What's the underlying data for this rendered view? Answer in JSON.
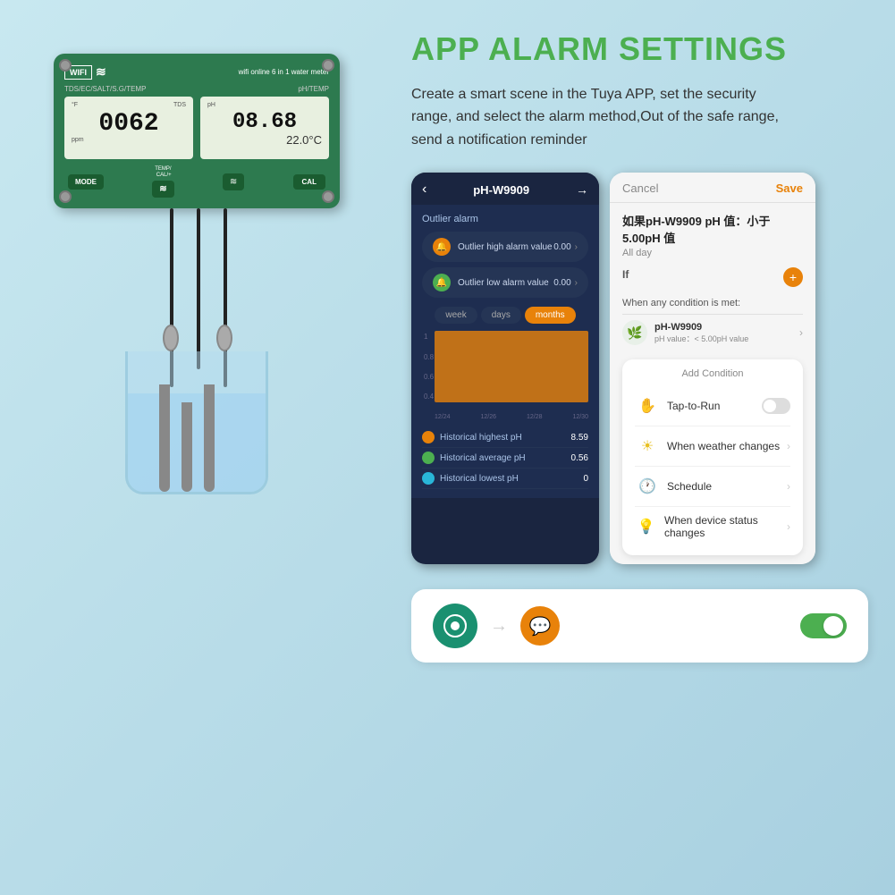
{
  "page": {
    "background": "#c8e8f0"
  },
  "header": {
    "title": "APP ALARM SETTINGS"
  },
  "description": {
    "text": "Create a smart scene in the Tuya APP, set the security range, and select the alarm method,Out of the safe range, send a notification reminder"
  },
  "device": {
    "wifi_label": "WIFI",
    "device_name": "wifi online 6 in 1 water meter",
    "left_screen_label_top": "TDS/EC/SALT/S.G/TEMP",
    "left_screen_unit": "ppm",
    "left_screen_value": "0062",
    "left_screen_sublabel": "TDS",
    "right_screen_label_top": "pH/TEMP",
    "right_screen_value": "08.68",
    "right_screen_temp": "22.0°C",
    "btn_mode": "MODE",
    "btn_cal": "CAL",
    "temp_label": "TEMP/\nCAL/+"
  },
  "phone_dark": {
    "back_icon": "‹",
    "title": "pH-W9909",
    "menu_icon": "≡",
    "section_title": "Outlier alarm",
    "alarm_high_label": "Outlier high alarm value",
    "alarm_high_value": "0.00",
    "alarm_low_label": "Outlier low alarm value",
    "alarm_low_value": "0.00",
    "tabs": [
      "week",
      "days",
      "months"
    ],
    "active_tab": "months",
    "chart_y_labels": [
      "1",
      "0.8",
      "0.6",
      "0.4"
    ],
    "chart_x_labels": [
      "12/24",
      "12/26",
      "12/28",
      "12/30"
    ],
    "stats": [
      {
        "label": "Historical highest pH",
        "value": "8.59",
        "color": "#e8820a"
      },
      {
        "label": "Historical average pH",
        "value": "0.56",
        "color": "#4caf50"
      },
      {
        "label": "Historical lowest pH",
        "value": "0",
        "color": "#29b6d8"
      }
    ]
  },
  "phone_white": {
    "cancel_label": "Cancel",
    "save_label": "Save",
    "condition_title": "如果pH-W9909 pH 值：小于 5.00pH 值",
    "all_day": "All day",
    "if_label": "If",
    "any_condition_text": "When any condition is met:",
    "device_name": "pH-W9909",
    "device_sub": "pH value：< 5.00pH value",
    "add_condition_title": "Add Condition",
    "conditions": [
      {
        "icon": "✋",
        "label": "Tap-to-Run",
        "has_toggle": true,
        "has_arrow": false
      },
      {
        "icon": "☀",
        "label": "When weather changes",
        "has_arrow": true,
        "has_toggle": false
      },
      {
        "icon": "🕐",
        "label": "Schedule",
        "has_arrow": true,
        "has_toggle": false
      },
      {
        "icon": "💡",
        "label": "When device status changes",
        "has_arrow": true,
        "has_toggle": false
      }
    ]
  },
  "bottom_card": {
    "toggle_active": true
  },
  "icons": {
    "arrow": "→",
    "chevron_right": "›",
    "back": "‹",
    "plus": "+"
  }
}
